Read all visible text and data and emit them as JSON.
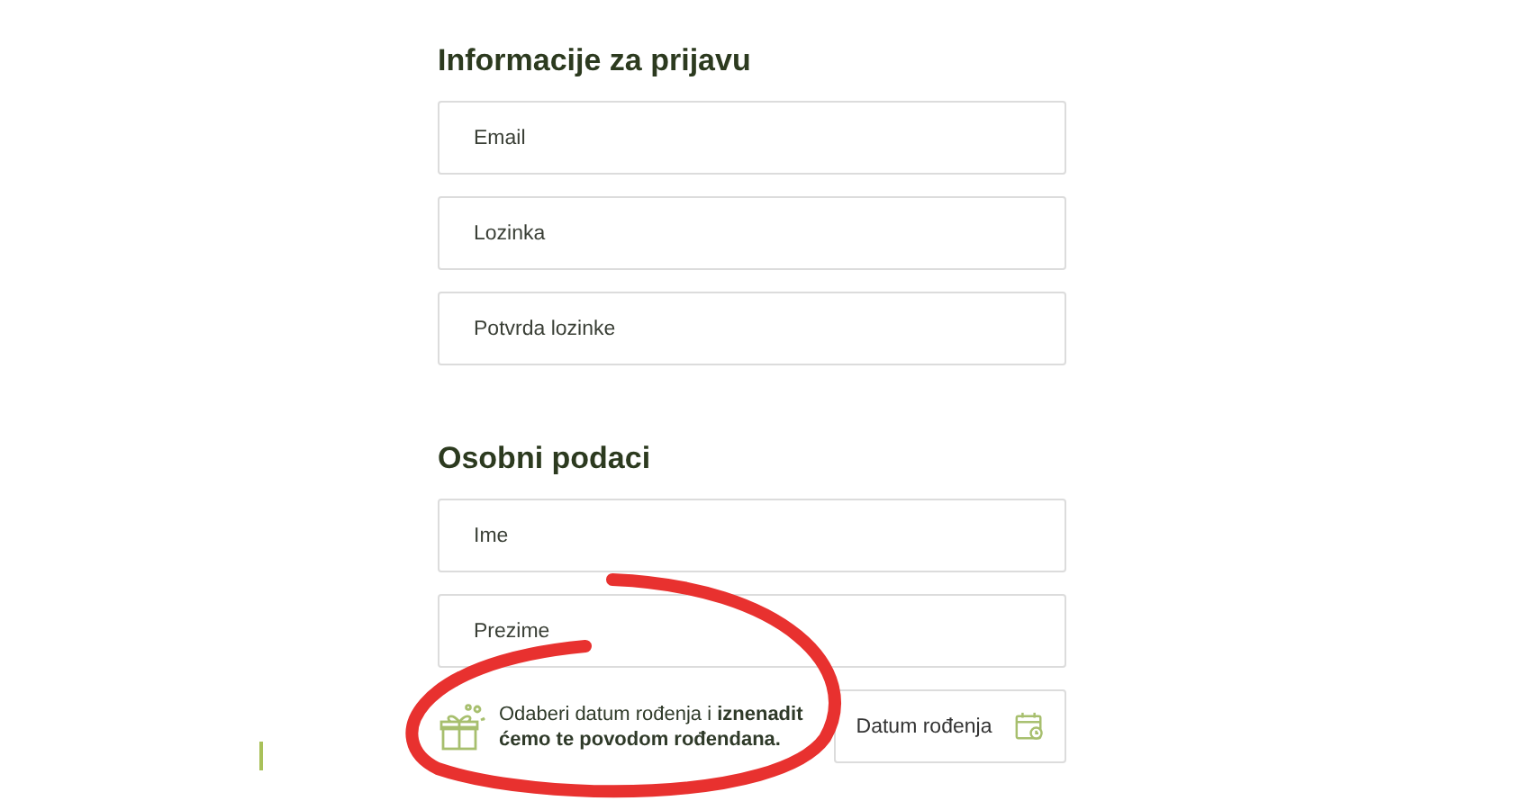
{
  "sections": [
    {
      "title": "Informacije za prijavu",
      "fields": [
        {
          "placeholder": "Email"
        },
        {
          "placeholder": "Lozinka"
        },
        {
          "placeholder": "Potvrda lozinke"
        }
      ]
    },
    {
      "title": "Osobni podaci",
      "fields": [
        {
          "placeholder": "Ime"
        },
        {
          "placeholder": "Prezime"
        }
      ]
    }
  ],
  "birthday": {
    "note": "Odaberi datum rođenja i **iznenadit ćemo te povodom rođendana.**",
    "button": "Datum rođenja"
  }
}
